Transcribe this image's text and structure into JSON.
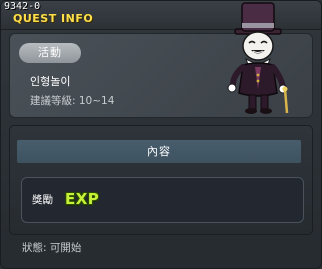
{
  "header": {
    "quest_id": "9342-0",
    "title": "QUEST INFO"
  },
  "quest": {
    "tag": "活動",
    "name": "인형놀이",
    "level_requirement": "建議等級: 10~14"
  },
  "content": {
    "header_label": "內容",
    "reward_label": "獎勵",
    "reward_badge": "EXP"
  },
  "status": {
    "text": "狀態:  可開始"
  },
  "npc": {
    "icon": "top-hat-doll-npc-icon"
  }
}
